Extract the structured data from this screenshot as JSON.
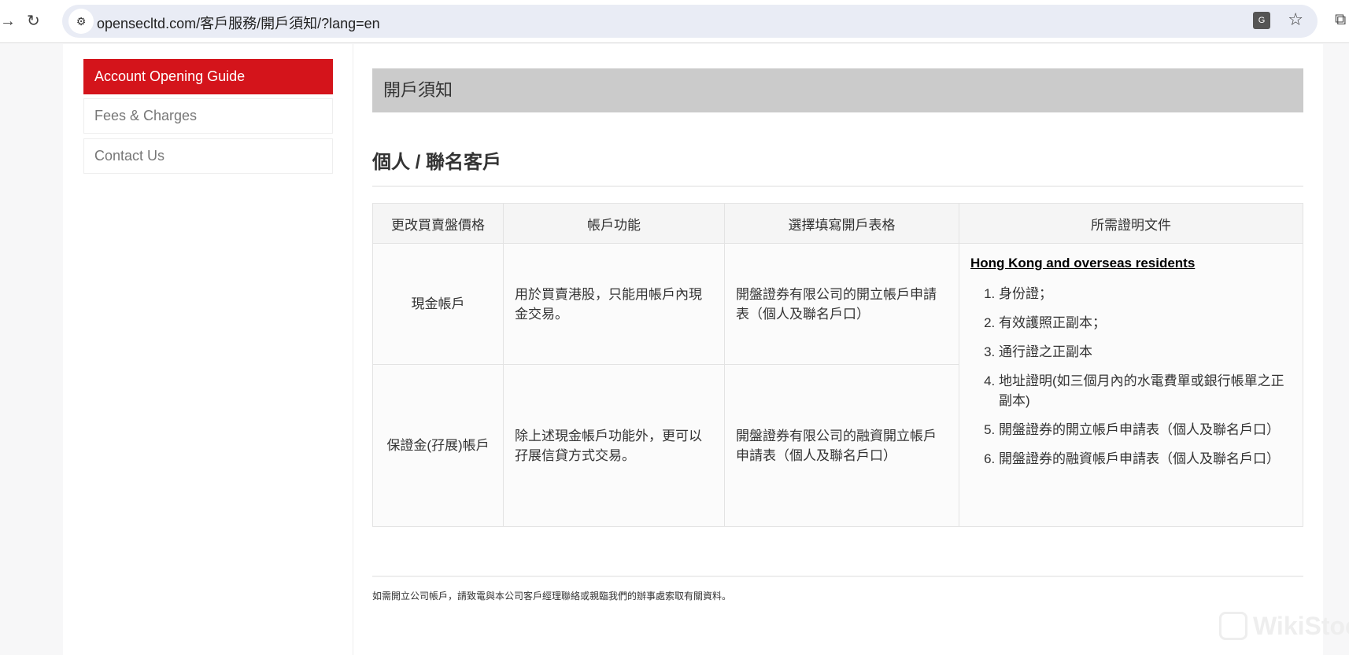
{
  "browser": {
    "url": "opensecltd.com/客戶服務/開戶須知/?lang=en"
  },
  "sidebar": {
    "items": [
      {
        "label": "Account Opening Guide",
        "active": true
      },
      {
        "label": "Fees & Charges"
      },
      {
        "label": "Contact Us"
      }
    ]
  },
  "main": {
    "title": "開戶須知",
    "subtitle": "個人 / 聯名客戶",
    "table": {
      "headers": [
        "更改買賣盤價格",
        "帳戶功能",
        "選擇填寫開戶表格",
        "所需證明文件"
      ],
      "rows": [
        {
          "type": "現金帳戶",
          "function": "用於買賣港股，只能用帳戶內現金交易。",
          "form": "開盤證券有限公司的開立帳戶申請表（個人及聯名戶口）"
        },
        {
          "type": "保證金(孖展)帳戶",
          "function": "除上述現金帳戶功能外，更可以孖展信貸方式交易。",
          "form": "開盤證券有限公司的融資開立帳戶申請表（個人及聯名戶口）"
        }
      ],
      "docs_heading": "Hong Kong and overseas residents",
      "docs": [
        "身份證；",
        "有效護照正副本；",
        "通行證之正副本",
        "地址證明(如三個月內的水電費單或銀行帳單之正副本)",
        "開盤證券的開立帳戶申請表（個人及聯名戶口）",
        "開盤證券的融資帳戶申請表（個人及聯名戶口）"
      ]
    },
    "note": "如需開立公司帳戶，請致電與本公司客戶經理聯絡或親臨我們的辦事處索取有關資料。"
  },
  "watermark": "WikiStock",
  "colors": {
    "accent": "#d4141b",
    "header_bar": "#cbcbcb"
  }
}
